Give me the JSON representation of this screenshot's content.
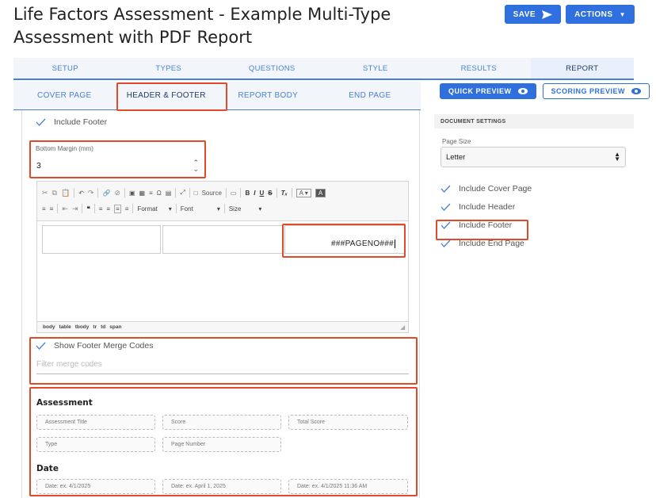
{
  "page": {
    "title": "Life Factors Assessment - Example Multi-Type Assessment with PDF Report"
  },
  "actions": {
    "save_label": "SAVE",
    "actions_label": "ACTIONS"
  },
  "main_tabs": [
    {
      "label": "SETUP"
    },
    {
      "label": "TYPES"
    },
    {
      "label": "QUESTIONS"
    },
    {
      "label": "STYLE"
    },
    {
      "label": "RESULTS"
    },
    {
      "label": "REPORT",
      "active": true
    }
  ],
  "sub_tabs": [
    {
      "label": "COVER PAGE"
    },
    {
      "label": "HEADER & FOOTER",
      "active": true
    },
    {
      "label": "REPORT BODY"
    },
    {
      "label": "END PAGE"
    }
  ],
  "preview": {
    "quick_label": "QUICK PREVIEW",
    "scoring_label": "SCORING PREVIEW"
  },
  "footer": {
    "include_footer_label": "Include Footer",
    "bottom_margin_label": "Bottom Margin (mm)",
    "bottom_margin_value": "3"
  },
  "editor": {
    "source_label": "Source",
    "format_label": "Format",
    "font_label": "Font",
    "size_label": "Size",
    "cell_text": "###PAGENO###",
    "path": [
      "body",
      "table",
      "tbody",
      "tr",
      "td",
      "span"
    ]
  },
  "merge": {
    "show_label": "Show Footer Merge Codes",
    "filter_placeholder": "Filter merge codes",
    "groups": [
      {
        "title": "Assessment",
        "codes": [
          "Assessment Title",
          "Score",
          "Total Score",
          "Type",
          "Page Number"
        ]
      },
      {
        "title": "Date",
        "codes": [
          "Date: ex. 4/1/2025",
          "Date: ex. April 1, 2025",
          "Date: ex. 4/1/2025 11:36 AM"
        ]
      }
    ]
  },
  "document_settings": {
    "heading": "DOCUMENT SETTINGS",
    "page_size_label": "Page Size",
    "page_size_value": "Letter",
    "options": [
      {
        "label": "Include Cover Page",
        "checked": true
      },
      {
        "label": "Include Header",
        "checked": true
      },
      {
        "label": "Include Footer",
        "checked": true
      },
      {
        "label": "Include End Page",
        "checked": true
      }
    ]
  },
  "colors": {
    "primary": "#2f6fde",
    "highlight": "#e24a2a"
  }
}
